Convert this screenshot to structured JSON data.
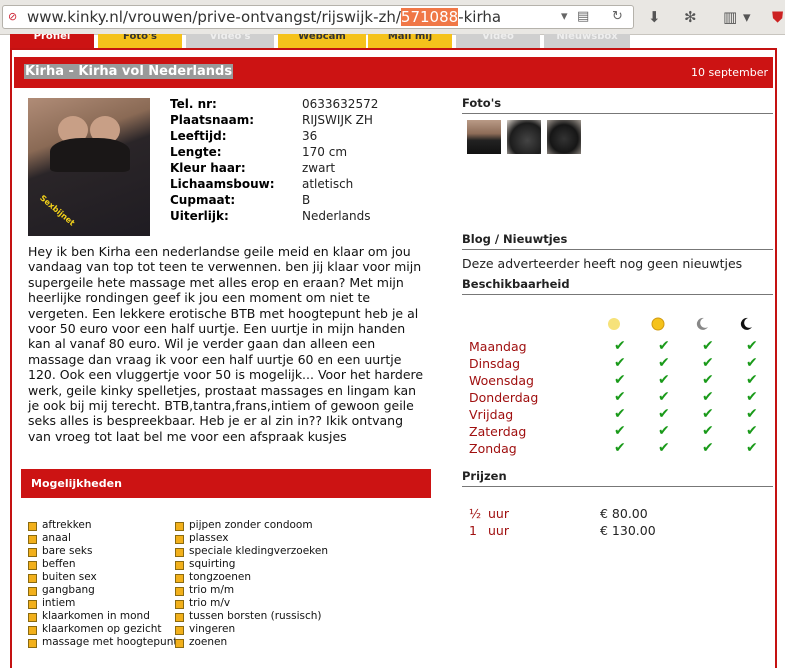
{
  "browser": {
    "url_before": "www.kinky.nl/vrouwen/prive-ontvangst/rijswijk-zh/",
    "url_highlight": "571088",
    "url_after": "-kirha"
  },
  "tabs": [
    {
      "label": "Profiel"
    },
    {
      "label": "Foto's"
    },
    {
      "label": "Video's"
    },
    {
      "label": "Webcam"
    },
    {
      "label": "Mail mij"
    },
    {
      "label": "Video"
    },
    {
      "label": "Nieuwsbox"
    }
  ],
  "profile": {
    "title": "Kirha - Kirha vol Nederlands",
    "date": "10 september",
    "photo_caption": "Sexbijnet",
    "fields": [
      {
        "key": "Tel. nr:",
        "value": "0633632572"
      },
      {
        "key": "Plaatsnaam:",
        "value": "RIJSWIJK ZH"
      },
      {
        "key": "Leeftijd:",
        "value": "36"
      },
      {
        "key": "Lengte:",
        "value": "170 cm"
      },
      {
        "key": "Kleur haar:",
        "value": "zwart"
      },
      {
        "key": "Lichaamsbouw:",
        "value": "atletisch"
      },
      {
        "key": "Cupmaat:",
        "value": "B"
      },
      {
        "key": "Uiterlijk:",
        "value": "Nederlands"
      }
    ],
    "description": "Hey ik ben Kirha een nederlandse geile meid en klaar om jou vandaag van top tot teen te verwennen. ben jij klaar voor mijn supergeile hete massage met alles erop en eraan? Met mijn heerlijke rondingen geef ik jou een moment om niet te vergeten. Een lekkere erotische BTB met hoogtepunt heb je al voor 50 euro voor een half uurtje. Een uurtje in mijn handen kan al vanaf 80 euro. Wil je verder gaan dan alleen een massage dan vraag ik voor een half uurtje 60 en een uurtje 120. Ook een vluggertje voor 50 is mogelijk... Voor het hardere werk, geile kinky spelletjes, prostaat massages en lingam kan je ook bij mij terecht. BTB,tantra,frans,intiem of gewoon geile seks alles is bespreekbaar. Heb je er al zin in?? Ikik ontvang van vroeg tot laat bel me voor een afspraak kusjes"
  },
  "mogelijkheden": {
    "title": "Mogelijkheden",
    "col1": [
      "aftrekken",
      "anaal",
      "bare seks",
      "beffen",
      "buiten sex",
      "gangbang",
      "intiem",
      "klaarkomen in mond",
      "klaarkomen op gezicht",
      "massage met hoogtepunt"
    ],
    "col2": [
      "pijpen zonder condoom",
      "plassex",
      "speciale kledingverzoeken",
      "squirting",
      "tongzoenen",
      "trio m/m",
      "trio m/v",
      "tussen borsten (russisch)",
      "vingeren",
      "zoenen"
    ]
  },
  "sidebar": {
    "photos_title": "Foto's",
    "blog_title": "Blog / Nieuwtjes",
    "blog_text": "Deze adverteerder heeft nog geen nieuwtjes",
    "availability_title": "Beschikbaarheid",
    "days": [
      "Maandag",
      "Dinsdag",
      "Woensdag",
      "Donderdag",
      "Vrijdag",
      "Zaterdag",
      "Zondag"
    ],
    "periods": [
      "morning-sun-icon",
      "afternoon-sun-icon",
      "evening-moon-icon",
      "night-moon-icon"
    ],
    "check_glyph": "✔",
    "prices_title": "Prijzen",
    "prices": [
      {
        "qty": "½",
        "unit": "uur",
        "price": "€ 80.00"
      },
      {
        "qty": "1",
        "unit": "uur",
        "price": "€ 130.00"
      }
    ]
  },
  "colors": {
    "brand_red": "#cc1313",
    "tab_yellow": "#f5c21b",
    "tab_grey": "#cfcfcf",
    "check_green": "#1a9a1a"
  }
}
